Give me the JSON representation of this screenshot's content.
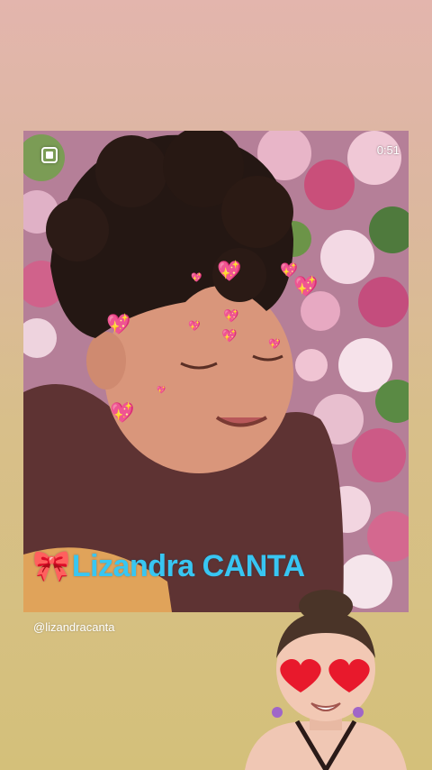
{
  "video": {
    "duration": "0:51",
    "caption_emoji": "🎀",
    "caption": "Lizandra CANTA"
  },
  "story": {
    "handle": "@lizandracanta"
  },
  "icons": {
    "mute": "mute-icon",
    "hearts": "sparkling-heart-icon",
    "avatar": "memoji-avatar-heart-eyes"
  },
  "colors": {
    "caption": "#38c6f2",
    "hearts": "#ff4fa3",
    "background_top": "#e3b5ad",
    "background_bottom": "#d4c07a"
  }
}
